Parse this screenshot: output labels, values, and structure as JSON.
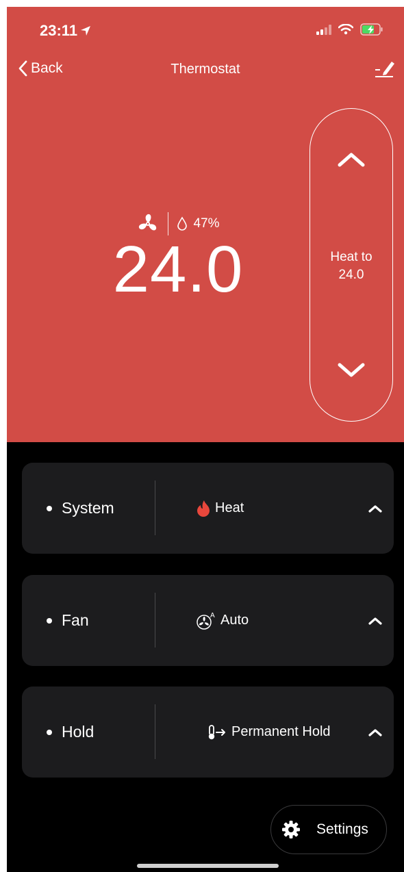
{
  "status": {
    "time": "23:11"
  },
  "nav": {
    "back_label": "Back",
    "title": "Thermostat"
  },
  "readout": {
    "humidity": "47%",
    "temperature": "24.0"
  },
  "setpoint": {
    "line1": "Heat to",
    "line2": "24.0"
  },
  "cards": [
    {
      "label": "System",
      "value": "Heat",
      "icon": "flame-icon"
    },
    {
      "label": "Fan",
      "value": "Auto",
      "icon": "fan-auto-icon"
    },
    {
      "label": "Hold",
      "value": "Permanent Hold",
      "icon": "thermometer-arrow-icon"
    }
  ],
  "settings": {
    "label": "Settings"
  },
  "colors": {
    "accent": "#d24c46",
    "card": "#1c1c1e",
    "flame": "#e8473c",
    "battery": "#4cd964"
  }
}
